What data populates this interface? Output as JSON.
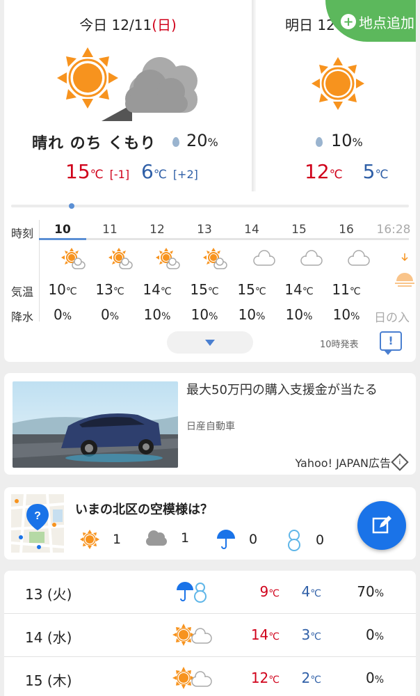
{
  "today": {
    "label": "今日",
    "date": "12/11",
    "weekday": "(日)",
    "weather": "晴れ のち くもり",
    "pop": "20",
    "pop_unit": "%",
    "high": "15",
    "high_diff": "[-1]",
    "low": "6",
    "low_diff": "[+2]",
    "unit": "℃"
  },
  "tomorrow": {
    "label": "明日 12",
    "pop": "10",
    "pop_unit": "%",
    "high": "12",
    "low": "5",
    "unit": "℃"
  },
  "add_location": {
    "label": "地点追加"
  },
  "hourly": {
    "row_labels": {
      "time": "時刻",
      "temp": "気温",
      "precip": "降水"
    },
    "hours": [
      "10",
      "11",
      "12",
      "13",
      "14",
      "15",
      "16",
      "16:28"
    ],
    "icons": [
      "sun-cloud-icon",
      "sun-cloud-icon",
      "sun-cloud-icon",
      "sun-cloud-icon",
      "cloud-icon",
      "cloud-icon",
      "cloud-icon",
      "sunset-icon"
    ],
    "temps": [
      "10",
      "13",
      "14",
      "15",
      "15",
      "14",
      "11"
    ],
    "precip": [
      "0",
      "0",
      "10",
      "10",
      "10",
      "10",
      "10"
    ],
    "temp_unit": "℃",
    "precip_unit": "%",
    "sunset_label": "日の入",
    "announce": "10時発表"
  },
  "ad": {
    "title": "最大50万円の購入支援金が当たる",
    "sponsor": "日産自動車",
    "label": "Yahoo! JAPAN広告"
  },
  "sky_report": {
    "title": "いまの北区の空模様は？",
    "counts": {
      "sunny": "1",
      "cloudy": "1",
      "rain": "0",
      "snow": "0"
    }
  },
  "daily": [
    {
      "date": "13",
      "weekday": "(火)",
      "icon": "umbrella-snowman-icon",
      "high": "9",
      "low": "4",
      "pop": "70"
    },
    {
      "date": "14",
      "weekday": "(水)",
      "icon": "sun-cloud-icon",
      "high": "14",
      "low": "3",
      "pop": "0"
    },
    {
      "date": "15",
      "weekday": "(木)",
      "icon": "sun-cloud-icon",
      "high": "12",
      "low": "2",
      "pop": "0"
    }
  ],
  "colors": {
    "high": "#d0021b",
    "low": "#2f5fa7",
    "accent": "#1a73e8",
    "add_green": "#5cb85c"
  }
}
